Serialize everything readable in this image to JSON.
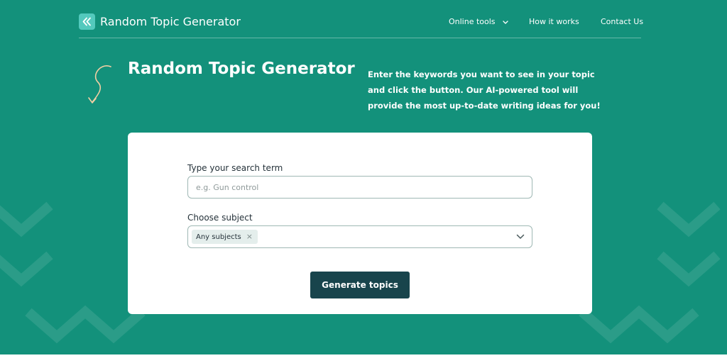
{
  "header": {
    "brand": "Random Topic Generator",
    "nav": [
      {
        "label": "Online tools"
      },
      {
        "label": "How it works"
      },
      {
        "label": "Contact Us"
      }
    ]
  },
  "intro": {
    "title": "Random Topic Generator",
    "description": "Enter the keywords you want to see in your topic and click the button. Our AI-powered tool will provide the most up-to-date writing ideas for you!"
  },
  "form": {
    "search": {
      "label": "Type your search term",
      "value": "",
      "placeholder": "e.g. Gun control"
    },
    "subject": {
      "label": "Choose subject",
      "selected": "Any subjects",
      "remove_glyph": "×"
    },
    "submit_label": "Generate topics"
  },
  "icons": {
    "logo": "double-chevron-left-icon",
    "nav_dropdown": "chevron-down-icon",
    "select_dropdown": "chevron-down-icon",
    "decoration": "curly-arrow-icon"
  },
  "colors": {
    "background": "#13917b",
    "logo": "#53c9bd",
    "button": "#18444c",
    "arrow": "#f2cfa4",
    "card": "#ffffff"
  }
}
